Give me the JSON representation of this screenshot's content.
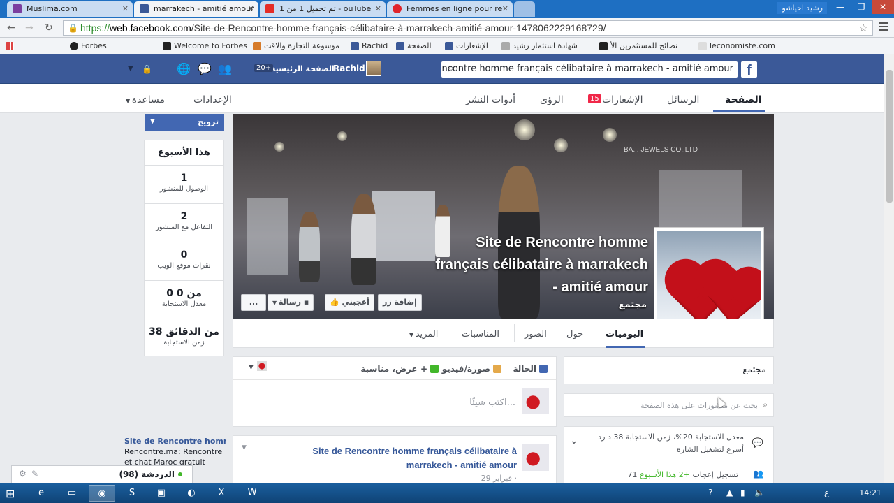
{
  "browser": {
    "tabs": [
      {
        "title": "Muslima.com",
        "color": "#7b3fa0"
      },
      {
        "title": "marrakech - amitié amour",
        "color": "#3b5998"
      },
      {
        "title": "تم تحميل 1 من 1 - ouTube",
        "color": "#e52d27"
      },
      {
        "title": "Femmes en ligne pour re",
        "color": "#e0242b"
      }
    ],
    "window_user": "رشيد احياشو",
    "url_https": "https://",
    "url_host": "web.facebook.com",
    "url_path": "/Site-de-Rencontre-homme-français-célibataire-à-marrakech-amitié-amour-1478062229168729/",
    "bookmarks": [
      {
        "label": "Forbes",
        "color": "#222"
      },
      {
        "label": "Welcome to Forbes",
        "color": "#222"
      },
      {
        "label": "موسوعة التجارة والاقت",
        "color": "#d67b2a"
      },
      {
        "label": "Rachid",
        "color": "#3b5998"
      },
      {
        "label": "الصفحة",
        "color": "#3b5998"
      },
      {
        "label": "الإشعارات",
        "color": "#3b5998"
      },
      {
        "label": "شهادة استثمار رشيد",
        "color": "#555"
      },
      {
        "label": "نصائح للمستثمرين الأ",
        "color": "#222"
      },
      {
        "label": "leconomiste.com",
        "color": "#ccc"
      }
    ]
  },
  "fb": {
    "search_value": "Site de Rencontre homme français célibataire à marrakech - amitié amour",
    "user_name": "Rachid",
    "home_label": "الصفحة الرئيسية",
    "home_count": "20+"
  },
  "page_nav": {
    "page": "الصفحة",
    "messages": "الرسائل",
    "notifications": "الإشعارات",
    "notifications_count": "15",
    "insights": "الرؤى",
    "publishing_tools": "أدوات النشر",
    "settings": "الإعدادات",
    "help": "مساعدة"
  },
  "left": {
    "promote": "ترويج",
    "week_title": "هذا الأسبوع",
    "stats": [
      {
        "value": "1",
        "label": "الوصول للمنشور"
      },
      {
        "value": "2",
        "label": "التفاعل مع المنشور"
      },
      {
        "value": "0",
        "label": "نقرات موقع الويب"
      },
      {
        "value": "0 من 0",
        "label": "معدل الاستجابة"
      },
      {
        "value": "38 من الدقائق",
        "label": "زمن الاستجابة"
      }
    ]
  },
  "cover": {
    "title": "Site de Rencontre homme français célibataire à marrakech - amitié amour",
    "category": "مجتمع",
    "sign_text": "BA... JEWELS CO.,LTD",
    "buttons": {
      "add_button": "إضافة زر",
      "like": "أعجبني",
      "message": "رسالة",
      "more": "..."
    }
  },
  "cover_tabs": {
    "timeline": "اليوميات",
    "about": "حول",
    "photos": "الصور",
    "events": "المناسبات",
    "more": "المزيد"
  },
  "composer": {
    "status": "الحالة",
    "photo_video": "صورة/فيديو",
    "offer_event": "عرض، مناسبة +",
    "placeholder": "اكتب شيئًا..."
  },
  "post": {
    "title": "Site de Rencontre homme français célibataire à marrakech - amitié amour",
    "date": "29 فبراير ·"
  },
  "right": {
    "about_category": "مجتمع",
    "search_placeholder": "بحث عن منشورات على هذه الصفحة",
    "insight_response": "معدل الاستجابة 20%، زمن الاستجابة 38 د رد أسرع لتشغيل الشارة",
    "insight_likes_prefix": "71 تسجيل إعجاب",
    "insight_likes_highlight": "+2 هذا الأسبوع"
  },
  "chat": {
    "suggest_name": "Site de Rencontre homm...",
    "suggest_text": "Rencontre.ma: Rencontre et chat Maroc gratuit",
    "label": "الدردشة (98)"
  },
  "taskbar": {
    "clock": "14:21",
    "lang": "ع"
  }
}
